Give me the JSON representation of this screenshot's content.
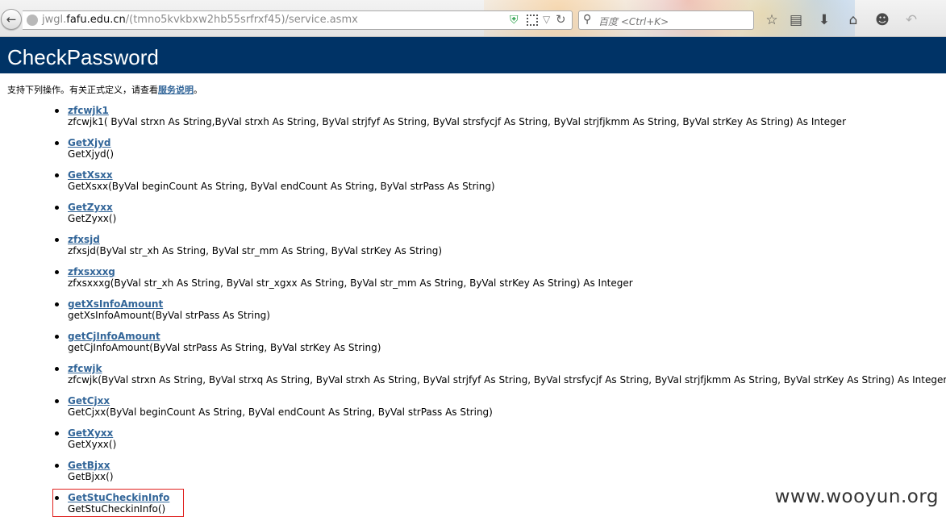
{
  "browser": {
    "url": "jwgl.fafu.edu.cn/(tmno5kvkbxw2hb55srfrxf45)/service.asmx",
    "url_prefix": "jwgl.",
    "url_domain": "fafu.edu.cn",
    "url_path": "/(tmno5kvkbxw2hb55srfrxf45)/service.asmx",
    "search_placeholder": "百度 <Ctrl+K>"
  },
  "icons": {
    "back": "back-arrow-icon",
    "globe": "globe-icon",
    "shield": "shield-icon",
    "qr": "qr-code-icon",
    "dropdown": "dropdown-arrow-icon",
    "reload": "reload-icon",
    "search": "search-icon",
    "bookmark": "star-icon",
    "reading_list": "list-icon",
    "download": "download-icon",
    "home": "home-icon",
    "smiley": "smiley-icon",
    "undo": "undo-icon"
  },
  "header": {
    "title": "CheckPassword",
    "background": "#003366"
  },
  "intro": {
    "text_before": "支持下列操作。有关正式定义，请查看",
    "link_text": "服务说明",
    "text_after": "。"
  },
  "operations": [
    {
      "name": "zfcwjk1",
      "signature": "zfcwjk1( ByVal strxn As String,ByVal strxh As String, ByVal strjfyf As String, ByVal strsfycjf As String, ByVal strjfjkmm As String, ByVal strKey As String) As Integer"
    },
    {
      "name": "GetXjyd",
      "signature": "GetXjyd()"
    },
    {
      "name": "GetXsxx",
      "signature": "GetXsxx(ByVal beginCount As String, ByVal endCount As String, ByVal strPass As String)"
    },
    {
      "name": "GetZyxx",
      "signature": "GetZyxx()"
    },
    {
      "name": "zfxsjd",
      "signature": "zfxsjd(ByVal str_xh As String, ByVal str_mm As String, ByVal strKey As String)"
    },
    {
      "name": "zfxsxxxg",
      "signature": "zfxsxxxg(ByVal str_xh As String, ByVal str_xgxx As String, ByVal str_mm As String, ByVal strKey As String) As Integer"
    },
    {
      "name": "getXsInfoAmount",
      "signature": "getXsInfoAmount(ByVal strPass As String)"
    },
    {
      "name": "getCjInfoAmount",
      "signature": "getCjInfoAmount(ByVal strPass As String, ByVal strKey As String)"
    },
    {
      "name": "zfcwjk",
      "signature": "zfcwjk(ByVal strxn As String, ByVal strxq As String, ByVal strxh As String, ByVal strjfyf As String, ByVal strsfycjf As String, ByVal strjfjkmm As String, ByVal strKey As String) As Integer"
    },
    {
      "name": "GetCjxx",
      "signature": "GetCjxx(ByVal beginCount As String, ByVal endCount As String, ByVal strPass As String)"
    },
    {
      "name": "GetXyxx",
      "signature": "GetXyxx()"
    },
    {
      "name": "GetBjxx",
      "signature": "GetBjxx()"
    },
    {
      "name": "GetStuCheckinInfo",
      "signature": "GetStuCheckinInfo()"
    }
  ],
  "watermark": "www.wooyun.org",
  "colors": {
    "link": "#336699",
    "highlight_border": "#e0201e"
  }
}
